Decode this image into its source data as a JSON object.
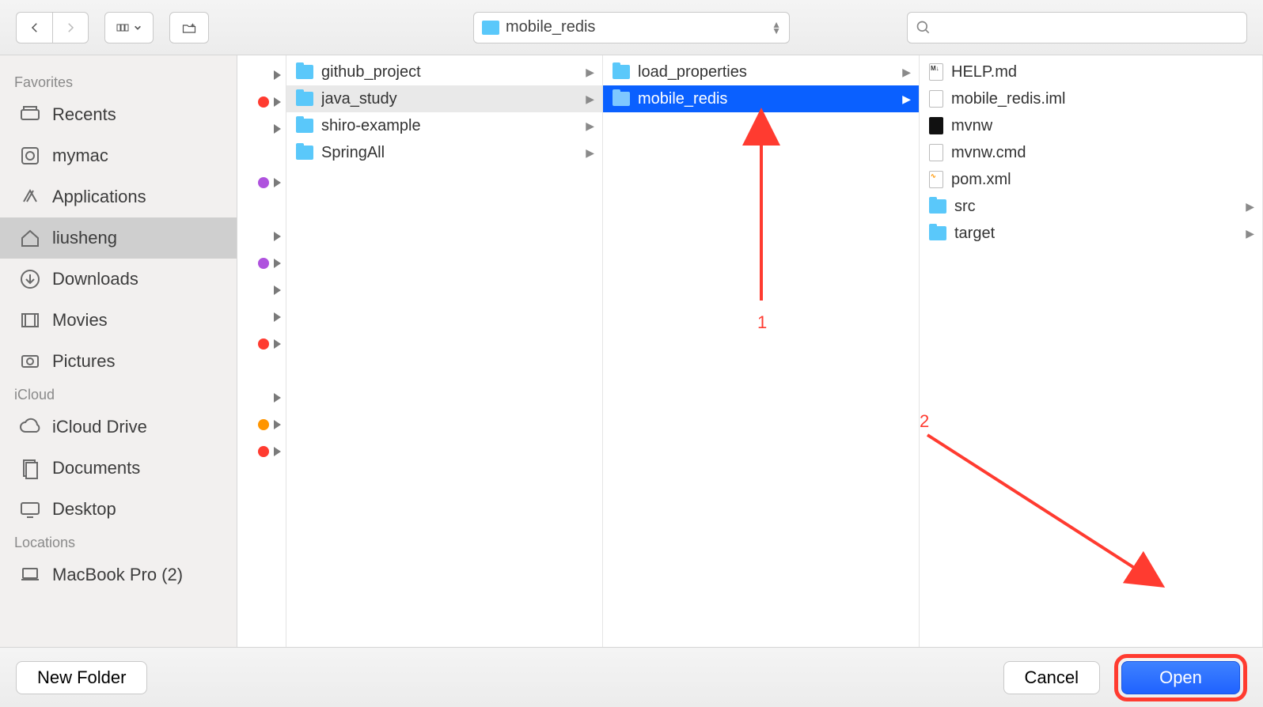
{
  "toolbar": {
    "path_label": "mobile_redis",
    "search_placeholder": ""
  },
  "sidebar": {
    "sections": [
      {
        "header": "Favorites",
        "items": [
          {
            "label": "Recents",
            "icon": "recents"
          },
          {
            "label": "mymac",
            "icon": "disk"
          },
          {
            "label": "Applications",
            "icon": "apps"
          },
          {
            "label": "liusheng",
            "icon": "home",
            "selected": true
          },
          {
            "label": "Downloads",
            "icon": "download"
          },
          {
            "label": "Movies",
            "icon": "movies"
          },
          {
            "label": "Pictures",
            "icon": "pictures"
          }
        ]
      },
      {
        "header": "iCloud",
        "items": [
          {
            "label": "iCloud Drive",
            "icon": "cloud"
          },
          {
            "label": "Documents",
            "icon": "docs"
          },
          {
            "label": "Desktop",
            "icon": "desktop"
          }
        ]
      },
      {
        "header": "Locations",
        "items": [
          {
            "label": "MacBook Pro (2)",
            "icon": "laptop"
          }
        ]
      }
    ]
  },
  "gutter_rows": [
    {
      "dot": null,
      "arrow": true
    },
    {
      "dot": "red",
      "arrow": true
    },
    {
      "dot": null,
      "arrow": true
    },
    {
      "dot": null,
      "arrow": false
    },
    {
      "dot": "purple",
      "arrow": true
    },
    {
      "dot": null,
      "arrow": false
    },
    {
      "dot": null,
      "arrow": true
    },
    {
      "dot": "purple",
      "arrow": true
    },
    {
      "dot": null,
      "arrow": true
    },
    {
      "dot": null,
      "arrow": true
    },
    {
      "dot": "red",
      "arrow": true
    },
    {
      "dot": null,
      "arrow": false
    },
    {
      "dot": null,
      "arrow": true
    },
    {
      "dot": "orange",
      "arrow": true
    },
    {
      "dot": "red",
      "arrow": true
    }
  ],
  "col1": [
    {
      "label": "github_project",
      "type": "folder",
      "arrow": true
    },
    {
      "label": "java_study",
      "type": "folder",
      "arrow": true,
      "dim": true
    },
    {
      "label": "shiro-example",
      "type": "folder",
      "arrow": true
    },
    {
      "label": "SpringAll",
      "type": "folder",
      "arrow": true
    }
  ],
  "col2": [
    {
      "label": "load_properties",
      "type": "folder",
      "arrow": true
    },
    {
      "label": "mobile_redis",
      "type": "folder",
      "arrow": true,
      "sel": true
    }
  ],
  "col3": [
    {
      "label": "HELP.md",
      "type": "file",
      "badge": "M↓"
    },
    {
      "label": "mobile_redis.iml",
      "type": "file"
    },
    {
      "label": "mvnw",
      "type": "exec"
    },
    {
      "label": "mvnw.cmd",
      "type": "file"
    },
    {
      "label": "pom.xml",
      "type": "xml"
    },
    {
      "label": "src",
      "type": "folder",
      "arrow": true
    },
    {
      "label": "target",
      "type": "folder",
      "arrow": true
    }
  ],
  "footer": {
    "new_folder": "New Folder",
    "cancel": "Cancel",
    "open": "Open"
  },
  "annotations": {
    "label1": "1",
    "label2": "2"
  }
}
